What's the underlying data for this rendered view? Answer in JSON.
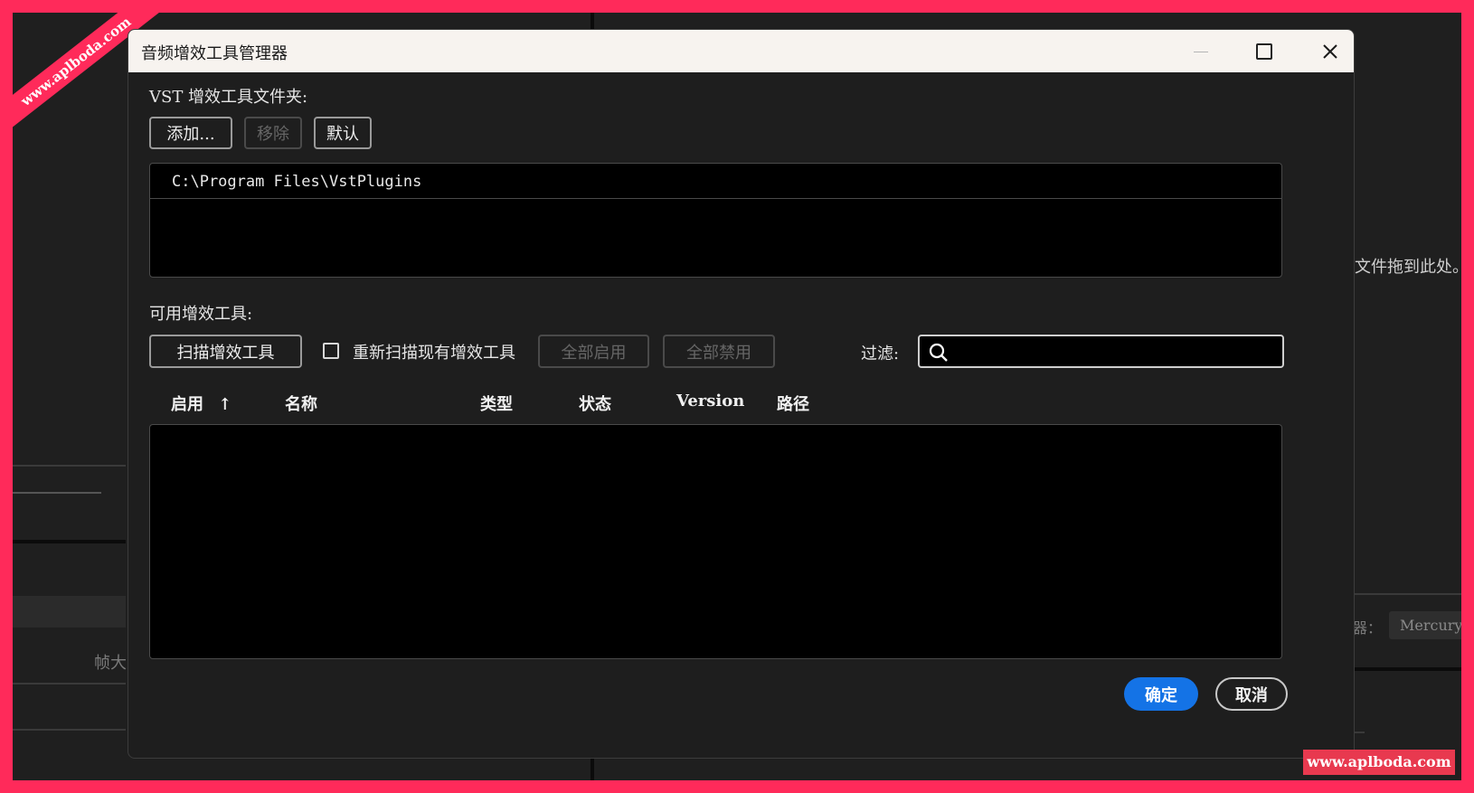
{
  "watermark": {
    "corner": "www.aplboda.com",
    "bottom": "www.aplboda.com"
  },
  "background": {
    "drop_hint": "文件拖到此处。",
    "frame_label": "帧大",
    "renderer_label": "器：",
    "renderer_value": "Mercury"
  },
  "dialog": {
    "title": "音频增效工具管理器",
    "window_controls": {
      "minimize": "minimize-icon",
      "maximize": "maximize-icon",
      "close": "close-icon"
    },
    "vst_folders": {
      "label": "VST 增效工具文件夹:",
      "add_button": "添加...",
      "remove_button": "移除",
      "default_button": "默认",
      "folders": [
        "C:\\Program Files\\VstPlugins"
      ]
    },
    "available": {
      "label": "可用增效工具:",
      "scan_button": "扫描增效工具",
      "rescan_checkbox": {
        "label": "重新扫描现有增效工具",
        "checked": false
      },
      "enable_all_button": "全部启用",
      "disable_all_button": "全部禁用",
      "filter_label": "过滤:",
      "filter_value": "",
      "columns": [
        "启用",
        "名称",
        "类型",
        "状态",
        "Version",
        "路径"
      ],
      "sort_indicator": "↑",
      "rows": []
    },
    "ok_button": "确定",
    "cancel_button": "取消"
  }
}
